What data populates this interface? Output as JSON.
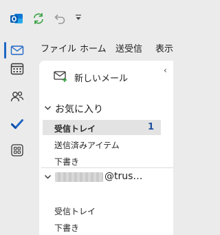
{
  "titlebar": {
    "icons": [
      "outlook-logo-icon",
      "sync-icon",
      "undo-icon",
      "quick-access-dropdown-icon"
    ]
  },
  "ribbon_tabs": [
    "ファイル",
    "ホーム",
    "送受信",
    "表示"
  ],
  "rail": {
    "items": [
      "mail-icon",
      "calendar-icon",
      "people-icon",
      "todo-check-icon",
      "apps-icon"
    ],
    "active": "mail-icon"
  },
  "folder_pane": {
    "new_mail_label": "新しいメール",
    "favorites": {
      "title": "お気に入り",
      "folders": [
        {
          "label": "受信トレイ",
          "count": "1",
          "selected": true
        },
        {
          "label": "送信済みアイテム",
          "count": ""
        },
        {
          "label": "下書き",
          "count": ""
        }
      ]
    },
    "account": {
      "suffix": "@trus…",
      "folders": [
        {
          "label": "受信トレイ"
        },
        {
          "label": "下書き"
        }
      ]
    }
  },
  "colors": {
    "accent": "#1f66c4",
    "unread_count": "#1f4fa0",
    "selected_bg": "#e3e3e3"
  }
}
